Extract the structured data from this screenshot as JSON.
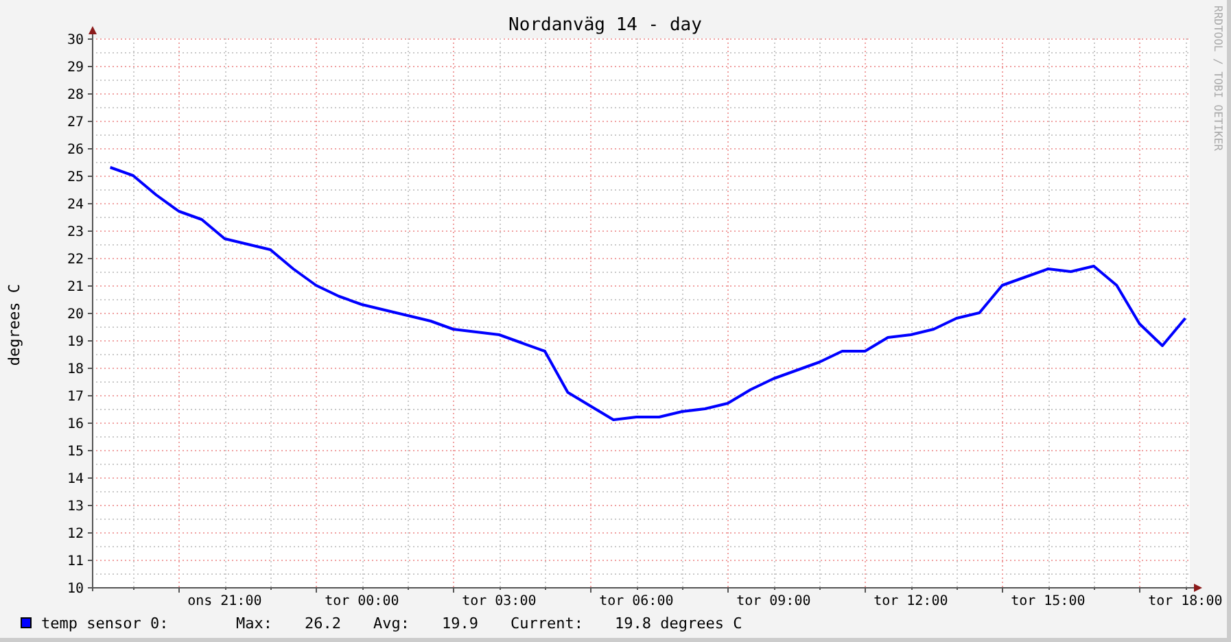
{
  "graph": {
    "title": "Nordanväg 14 - day",
    "watermark": "RRDTOOL / TOBI OETIKER",
    "chart_data": {
      "type": "line",
      "ylabel": "degrees C",
      "grid": true,
      "ylim": [
        10,
        30
      ],
      "categories": [
        null,
        null,
        null,
        null,
        null,
        "ons 21:00",
        null,
        null,
        null,
        null,
        null,
        "tor 00:00",
        null,
        null,
        null,
        null,
        null,
        "tor 03:00",
        null,
        null,
        null,
        null,
        null,
        "tor 06:00",
        null,
        null,
        null,
        null,
        null,
        "tor 09:00",
        null,
        null,
        null,
        null,
        null,
        "tor 12:00",
        null,
        null,
        null,
        null,
        null,
        "tor 15:00",
        null,
        null,
        null,
        null,
        null,
        "tor 18:00"
      ],
      "series": [
        {
          "color": "#0000ff",
          "values": [
            25.3,
            25.0,
            24.3,
            23.7,
            23.4,
            22.7,
            22.5,
            22.3,
            21.6,
            21.0,
            20.6,
            20.3,
            20.1,
            19.9,
            19.7,
            19.4,
            19.3,
            19.2,
            18.9,
            18.6,
            17.1,
            16.6,
            16.1,
            16.2,
            16.2,
            16.4,
            16.5,
            16.7,
            17.2,
            17.6,
            17.9,
            18.2,
            18.6,
            18.6,
            19.1,
            19.2,
            19.4,
            19.8,
            20.0,
            21.0,
            21.3,
            21.6,
            21.5,
            21.7,
            21.0,
            19.6,
            18.8,
            19.8
          ]
        }
      ],
      "yticks": [
        10,
        11,
        12,
        13,
        14,
        15,
        16,
        17,
        18,
        19,
        20,
        21,
        22,
        23,
        24,
        25,
        26,
        27,
        28,
        29,
        30
      ]
    },
    "legend": {
      "label": "temp sensor 0:",
      "max_label": "Max:",
      "max": "26.2",
      "avg_label": "Avg:",
      "avg": "19.9",
      "current_label": "Current:",
      "current": "19.8 degrees C"
    }
  }
}
